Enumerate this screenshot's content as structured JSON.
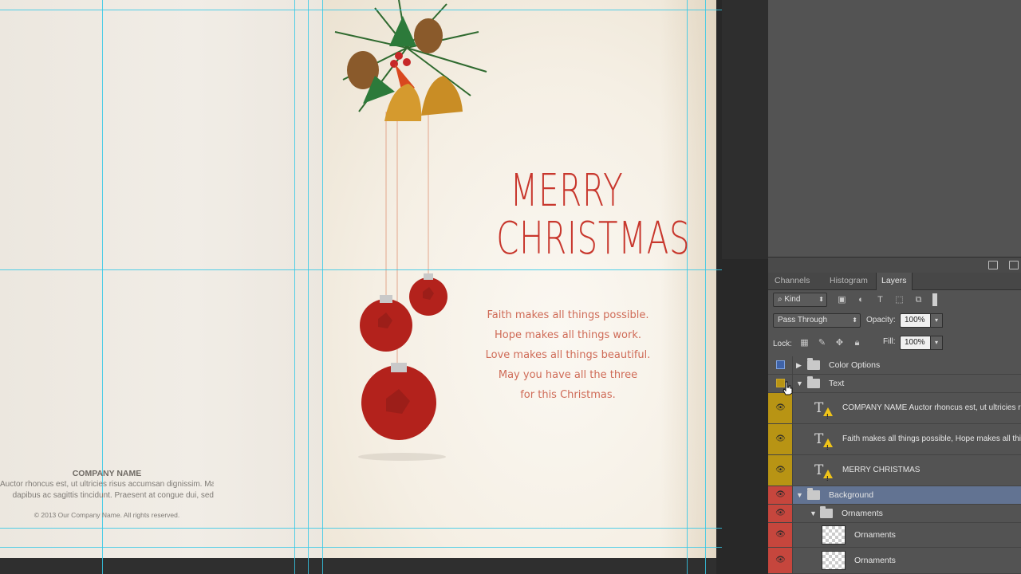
{
  "document": {
    "title_line1": "MERRY",
    "title_line2": "CHRISTMAS",
    "verse": [
      "Faith makes all things possible.",
      "Hope makes all things work.",
      "Love makes all things beautiful.",
      "May you have all the three",
      "for this Christmas."
    ],
    "company_name": "COMPANY NAME",
    "company_text_1": "Auctor rhoncus est, ut ultricies risus accumsan dignissim. Mauris",
    "company_text_2": "dapibus ac sagittis tincidunt. Praesent at congue dui, sed",
    "copyright": "© 2013 Our Company Name. All rights reserved."
  },
  "panel": {
    "tabs": [
      "Channels",
      "Histogram",
      "Layers"
    ],
    "active_tab": "Layers",
    "filter_kind": "Kind",
    "blend_mode": "Pass Through",
    "opacity_label": "Opacity:",
    "opacity_value": "100%",
    "lock_label": "Lock:",
    "fill_label": "Fill:",
    "fill_value": "100%",
    "colors": {
      "eye_blue": "#3f63a8",
      "eye_yellow": "#b89414",
      "eye_red": "#c6463d",
      "selected_row": "#627392"
    }
  },
  "layers": [
    {
      "name": "Color Options",
      "type": "group",
      "expanded": false,
      "visible": false,
      "color": "blue"
    },
    {
      "name": "Text",
      "type": "group",
      "expanded": true,
      "visible": false,
      "color": "yellow"
    },
    {
      "name": "COMPANY NAME Auctor rhoncus est, ut ultricies ri",
      "type": "text",
      "visible": true,
      "color": "yellow"
    },
    {
      "name": "Faith makes all things possible, Hope makes all thin",
      "type": "text",
      "visible": true,
      "color": "yellow"
    },
    {
      "name": "MERRY CHRISTMAS",
      "type": "text",
      "visible": true,
      "color": "yellow"
    },
    {
      "name": "Background",
      "type": "group",
      "expanded": true,
      "visible": true,
      "color": "red",
      "selected": true
    },
    {
      "name": "Ornaments",
      "type": "group",
      "expanded": true,
      "visible": true,
      "color": "red"
    },
    {
      "name": "Ornaments",
      "type": "pixel",
      "visible": true,
      "color": "red"
    },
    {
      "name": "Ornaments",
      "type": "pixel",
      "visible": true,
      "color": "red"
    }
  ]
}
